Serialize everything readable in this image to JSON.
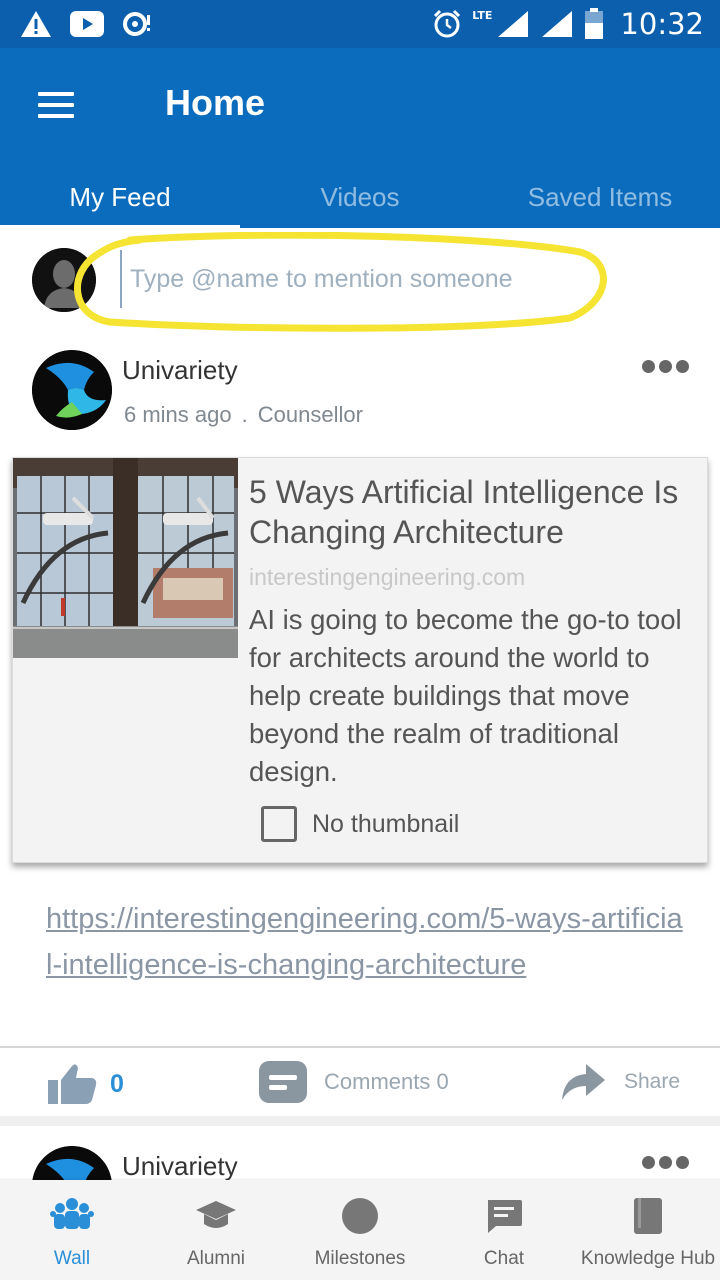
{
  "status_bar": {
    "time": "10:32",
    "network": "LTE",
    "icons": [
      "warning-icon",
      "youtube-icon",
      "sync-icon",
      "alarm-icon",
      "signal-icon",
      "signal-icon",
      "battery-icon"
    ]
  },
  "app_bar": {
    "title": "Home",
    "menu_icon": "hamburger-menu-icon"
  },
  "tabs": [
    {
      "label": "My Feed",
      "active": true
    },
    {
      "label": "Videos",
      "active": false
    },
    {
      "label": "Saved Items",
      "active": false
    }
  ],
  "composer": {
    "placeholder": "Type @name to mention someone",
    "highlight_color": "#f5e431"
  },
  "post": {
    "author": "Univariety",
    "time_ago": "6 mins ago",
    "separator": ".",
    "role": "Counsellor",
    "link_preview": {
      "title": "5 Ways Artificial Intelligence Is Changing Architecture",
      "domain": "interestingengineering.com",
      "description": "AI is going to become the go-to tool for architects around the world to help create buildings that move beyond the realm of traditional design.",
      "no_thumbnail_label": "No thumbnail",
      "no_thumbnail_checked": false
    },
    "link": "https://interestingengineering.com/5-ways-artificial-intelligence-is-changing-architecture",
    "likes": "0",
    "comments_label": "Comments 0",
    "share_label": "Share"
  },
  "post2": {
    "author": "Univariety"
  },
  "bottom_nav": [
    {
      "label": "Wall",
      "icon": "people-group-icon",
      "active": true
    },
    {
      "label": "Alumni",
      "icon": "graduation-cap-icon",
      "active": false
    },
    {
      "label": "Milestones",
      "icon": "circle-icon",
      "active": false
    },
    {
      "label": "Chat",
      "icon": "chat-bubble-icon",
      "active": false
    },
    {
      "label": "Knowledge Hub",
      "icon": "book-icon",
      "active": false
    }
  ],
  "colors": {
    "status_bar": "#0b5fad",
    "app_bar": "#0b6cbd",
    "accent": "#2a8fd6",
    "highlight": "#f5e431"
  }
}
